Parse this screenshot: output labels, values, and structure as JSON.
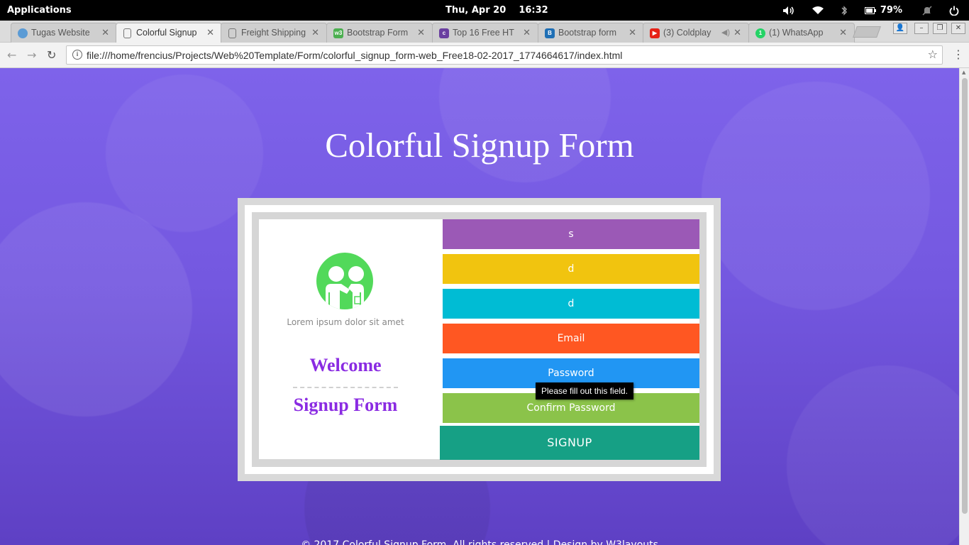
{
  "system_panel": {
    "applications": "Applications",
    "clock": "Thu, Apr 20    16:32",
    "battery_percent": "79%",
    "icons": [
      "volume-icon",
      "wifi-icon",
      "bluetooth-icon",
      "battery-icon",
      "notifications-muted-icon",
      "power-icon"
    ]
  },
  "tabs": [
    {
      "label": "Tugas Website",
      "icon": "tab-page-icon",
      "color": "#5b9bd5",
      "active": false
    },
    {
      "label": "Colorful Signup",
      "icon": "document-icon",
      "color": "#777777",
      "active": true
    },
    {
      "label": "Freight Shipping",
      "icon": "document-icon",
      "color": "#777777",
      "active": false
    },
    {
      "label": "Bootstrap Form",
      "icon": "w3schools-icon",
      "color": "#4caf50",
      "active": false
    },
    {
      "label": "Top 16 Free HT",
      "icon": "colorlib-icon",
      "color": "#6a3fa0",
      "active": false
    },
    {
      "label": "Bootstrap form",
      "icon": "bootstrap-icon",
      "color": "#1f6fb5",
      "active": false
    },
    {
      "label": "(3) Coldplay",
      "icon": "youtube-icon",
      "color": "#e62117",
      "active": false
    },
    {
      "label": "(1) WhatsApp",
      "icon": "whatsapp-icon",
      "color": "#25d366",
      "active": false
    }
  ],
  "address_bar": {
    "url": "file:///home/frencius/Projects/Web%20Template/Form/colorful_signup_form-web_Free18-02-2017_1774664617/index.html"
  },
  "page": {
    "title": "Colorful Signup Form",
    "left_panel": {
      "tagline": "Lorem ipsum dolor sit amet",
      "welcome": "Welcome",
      "signup_form": "Signup Form"
    },
    "fields": [
      {
        "name": "first-field",
        "value": "s",
        "color": "#9b59b6"
      },
      {
        "name": "second-field",
        "value": "d",
        "color": "#f1c40f"
      },
      {
        "name": "third-field",
        "value": "d",
        "color": "#00bcd4"
      },
      {
        "name": "email-field",
        "placeholder": "Email",
        "color": "#ff5722"
      },
      {
        "name": "password-field",
        "placeholder": "Password",
        "color": "#2196f3"
      },
      {
        "name": "confirm-password-field",
        "placeholder": "Confirm Password",
        "color": "#8bc34a"
      }
    ],
    "signup_button": "SIGNUP",
    "signup_button_color": "#16a085",
    "tooltip": "Please fill out this field.",
    "footer": "© 2017 Colorful Signup Form. All rights reserved | Design by W3layouts"
  }
}
